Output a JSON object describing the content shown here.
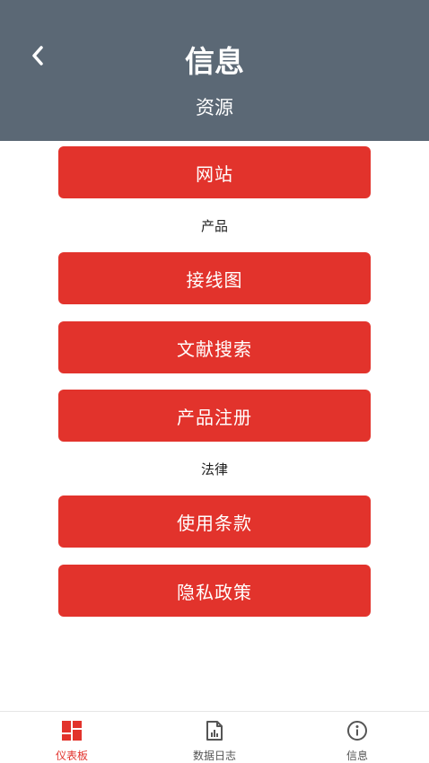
{
  "header": {
    "title": "信息",
    "subtitle": "资源"
  },
  "sections": {
    "products_label": "产品",
    "legal_label": "法律"
  },
  "buttons": {
    "website": "网站",
    "wiring_diagram": "接线图",
    "literature_search": "文献搜索",
    "product_registration": "产品注册",
    "terms_of_use": "使用条款",
    "privacy_policy": "隐私政策"
  },
  "tabbar": {
    "dashboard": "仪表板",
    "data_log": "数据日志",
    "info": "信息"
  },
  "colors": {
    "header_bg": "#5b6875",
    "button_red": "#e2332c",
    "active_tab": "#e2332c"
  },
  "icons": {
    "back": "chevron-left-icon",
    "dashboard": "dashboard-grid-icon",
    "data_log": "report-document-icon",
    "info": "info-circle-icon"
  }
}
